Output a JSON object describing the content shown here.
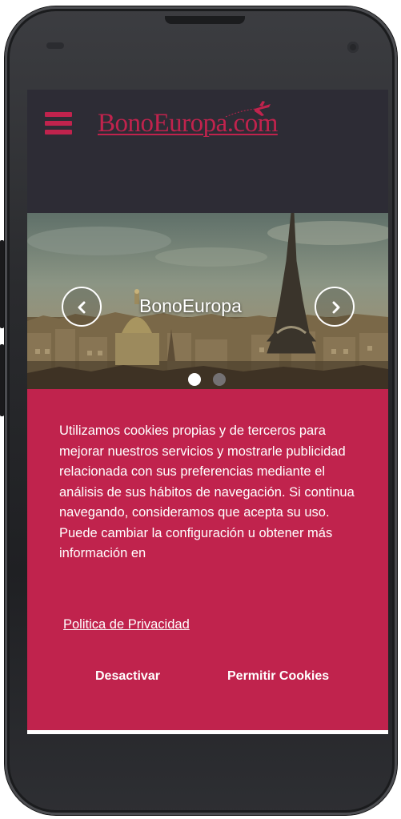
{
  "header": {
    "logo_text": "BonoEuropa.com",
    "menu_icon": "hamburger-menu-icon",
    "plane_icon": "airplane-icon",
    "background_color": "#2d2c35",
    "accent_color": "#c0234d"
  },
  "carousel": {
    "slide_title": "BonoEuropa",
    "prev_icon": "chevron-left-icon",
    "next_icon": "chevron-right-icon",
    "slide_count": 2,
    "active_slide": 1
  },
  "cookie_banner": {
    "background_color": "#c0234d",
    "message": "Utilizamos cookies propias y de terceros para mejorar nuestros servicios y mostrarle publicidad relacionada con sus preferencias mediante el análisis de sus hábitos de navegación. Si continua navegando, consideramos que acepta su uso. Puede cambiar la configuración u obtener más información en",
    "privacy_link": "Politica de Privacidad",
    "deactivate_label": "Desactivar",
    "allow_label": "Permitir Cookies"
  }
}
